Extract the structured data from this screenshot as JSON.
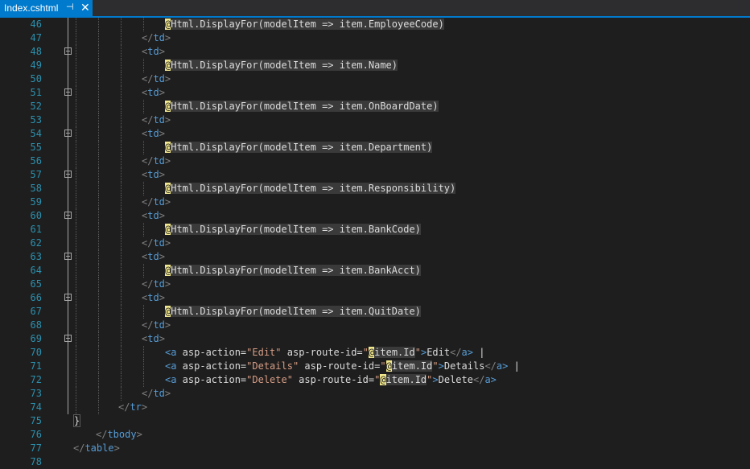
{
  "tab": {
    "title": "Index.cshtml",
    "pin_icon": "⊣",
    "close_icon": "✕"
  },
  "lines": [
    {
      "n": "46",
      "code": "@Html.DisplayFor(modelItem => item.EmployeeCode)"
    },
    {
      "n": "47",
      "code": "</td>"
    },
    {
      "n": "48",
      "code": "<td>"
    },
    {
      "n": "49",
      "code": "@Html.DisplayFor(modelItem => item.Name)"
    },
    {
      "n": "50",
      "code": "</td>"
    },
    {
      "n": "51",
      "code": "<td>"
    },
    {
      "n": "52",
      "code": "@Html.DisplayFor(modelItem => item.OnBoardDate)"
    },
    {
      "n": "53",
      "code": "</td>"
    },
    {
      "n": "54",
      "code": "<td>"
    },
    {
      "n": "55",
      "code": "@Html.DisplayFor(modelItem => item.Department)"
    },
    {
      "n": "56",
      "code": "</td>"
    },
    {
      "n": "57",
      "code": "<td>"
    },
    {
      "n": "58",
      "code": "@Html.DisplayFor(modelItem => item.Responsibility)"
    },
    {
      "n": "59",
      "code": "</td>"
    },
    {
      "n": "60",
      "code": "<td>"
    },
    {
      "n": "61",
      "code": "@Html.DisplayFor(modelItem => item.BankCode)"
    },
    {
      "n": "62",
      "code": "</td>"
    },
    {
      "n": "63",
      "code": "<td>"
    },
    {
      "n": "64",
      "code": "@Html.DisplayFor(modelItem => item.BankAcct)"
    },
    {
      "n": "65",
      "code": "</td>"
    },
    {
      "n": "66",
      "code": "<td>"
    },
    {
      "n": "67",
      "code": "@Html.DisplayFor(modelItem => item.QuitDate)"
    },
    {
      "n": "68",
      "code": "</td>"
    },
    {
      "n": "69",
      "code": "<td>"
    },
    {
      "n": "70",
      "code": "<a asp-action=\"Edit\" asp-route-id=\"@item.Id\">Edit</a> |"
    },
    {
      "n": "71",
      "code": "<a asp-action=\"Details\" asp-route-id=\"@item.Id\">Details</a> |"
    },
    {
      "n": "72",
      "code": "<a asp-action=\"Delete\" asp-route-id=\"@item.Id\">Delete</a>"
    },
    {
      "n": "73",
      "code": "</td>"
    },
    {
      "n": "74",
      "code": "</tr>"
    },
    {
      "n": "75",
      "code": "}"
    },
    {
      "n": "76",
      "code": "</tbody>"
    },
    {
      "n": "77",
      "code": "</table>"
    },
    {
      "n": "78",
      "code": ""
    }
  ],
  "colors": {
    "background": "#1e1e1e",
    "tab_active": "#007acc",
    "line_number": "#2b91af",
    "tag": "#569cd6",
    "attribute": "#92caf4",
    "string": "#d69d85",
    "razor_marker": "#f0e68c"
  }
}
